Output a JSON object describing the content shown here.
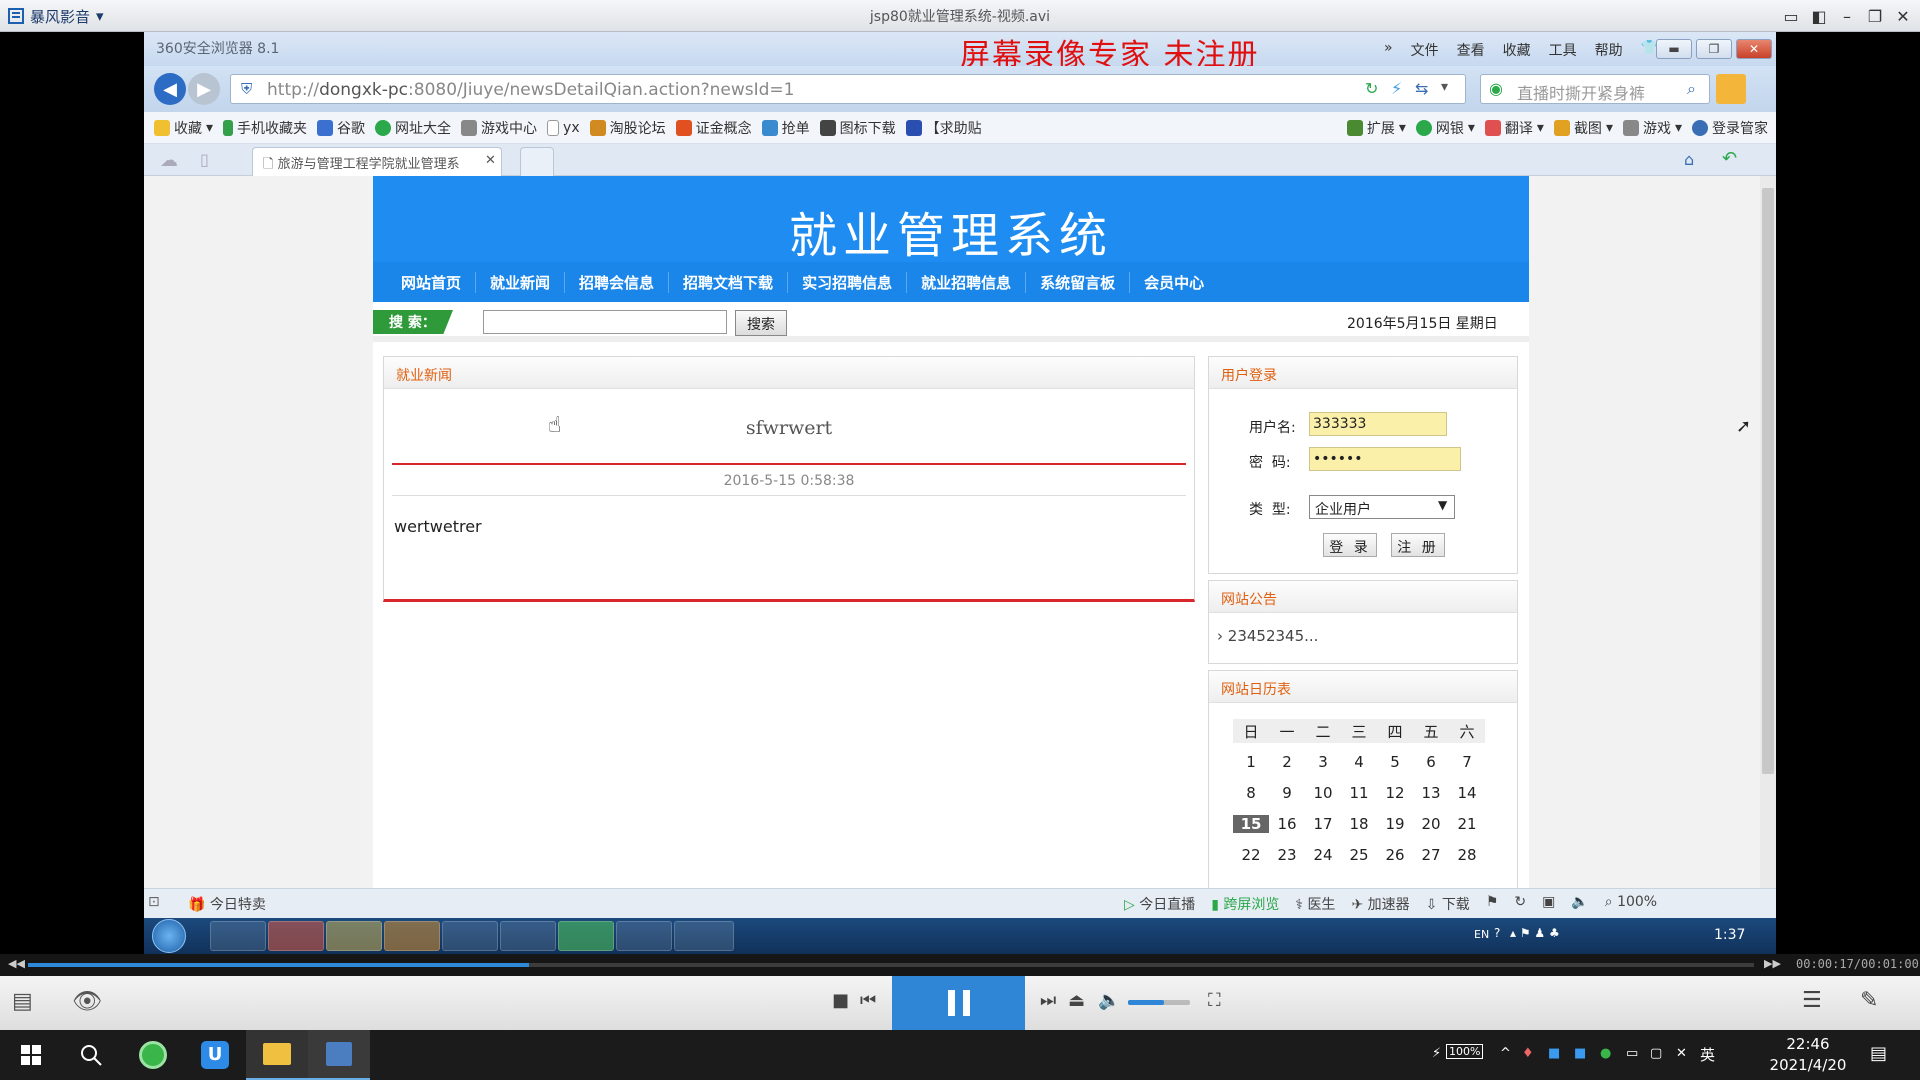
{
  "player": {
    "app_name": "暴风影音",
    "window_title": "jsp80就业管理系统-视频.avi",
    "time_display": "00:00:17/00:01:00",
    "progress": 0.29
  },
  "browser": {
    "name": "360安全浏览器 8.1",
    "menu": [
      "文件",
      "查看",
      "收藏",
      "工具",
      "帮助"
    ],
    "url_prefix": "http://",
    "url_host": "dongxk-pc",
    "url_rest": ":8080/Jiuye/newsDetailQian.action?newsId=1",
    "search_placeholder": "直播时撕开紧身裤",
    "favorites": [
      "收藏",
      "手机收藏夹",
      "谷歌",
      "网址大全",
      "游戏中心",
      "yx",
      "淘股论坛",
      "证金概念",
      "抢单",
      "图标下载",
      "【求助贴"
    ],
    "toolbar_right": [
      "扩展",
      "网银",
      "翻译",
      "截图",
      "游戏",
      "登录管家"
    ],
    "tab_title": "旅游与管理工程学院就业管理系",
    "status_left": "今日特卖",
    "status_right": [
      "今日直播",
      "跨屏浏览",
      "医生",
      "加速器",
      "下载",
      "100%"
    ]
  },
  "recorder_watermark": "屏幕录像专家  未注册",
  "site": {
    "title": "就业管理系统",
    "nav": [
      "网站首页",
      "就业新闻",
      "招聘会信息",
      "招聘文档下载",
      "实习招聘信息",
      "就业招聘信息",
      "系统留言板",
      "会员中心"
    ],
    "search_label": "搜 索：",
    "search_button": "搜索",
    "date": "2016年5月15日 星期日"
  },
  "news": {
    "section": "就业新闻",
    "title": "sfwrwert",
    "datetime": "2016-5-15 0:58:38",
    "body": "wertwetrer"
  },
  "login": {
    "section": "用户登录",
    "username_label": "用户名:",
    "username_value": "333333",
    "password_label": "密  码:",
    "password_value": "••••••",
    "type_label": "类  型:",
    "type_value": "企业用户",
    "login_button": "登 录",
    "register_button": "注 册"
  },
  "notice": {
    "section": "网站公告",
    "item": "23452345..."
  },
  "calendar": {
    "section": "网站日历表",
    "weekdays": [
      "日",
      "一",
      "二",
      "三",
      "四",
      "五",
      "六"
    ],
    "weeks": [
      [
        "1",
        "2",
        "3",
        "4",
        "5",
        "6",
        "7"
      ],
      [
        "8",
        "9",
        "10",
        "11",
        "12",
        "13",
        "14"
      ],
      [
        "15",
        "16",
        "17",
        "18",
        "19",
        "20",
        "21"
      ],
      [
        "22",
        "23",
        "24",
        "25",
        "26",
        "27",
        "28"
      ]
    ],
    "today": "15"
  },
  "inner_taskbar": {
    "time": "1:37",
    "lang": "EN"
  },
  "windows": {
    "time": "22:46",
    "date": "2021/4/20",
    "battery": "100%",
    "ime": "英"
  },
  "colors": {
    "site_blue": "#1e8cf0",
    "accent_red": "#d9262a",
    "section_orange": "#e06010",
    "player_blue": "#2f86d6"
  }
}
